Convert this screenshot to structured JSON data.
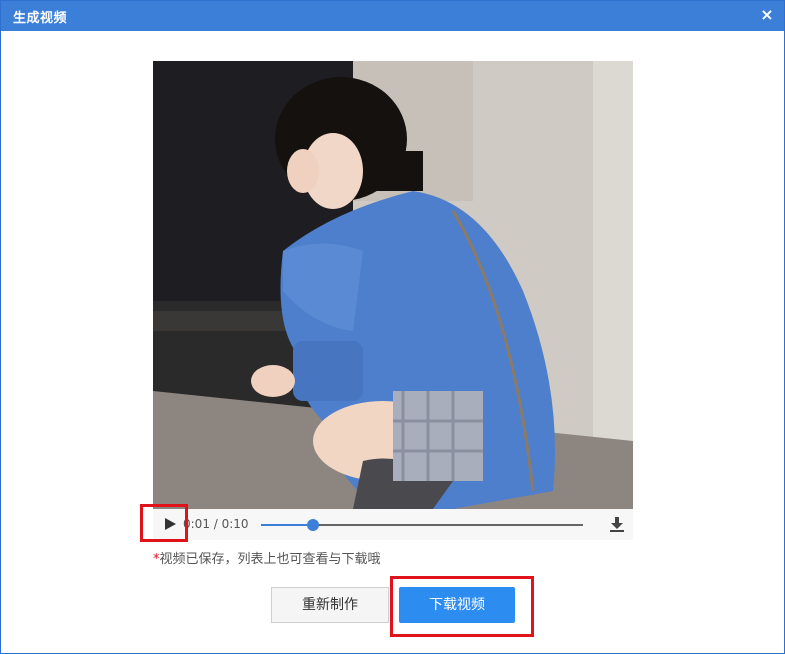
{
  "dialog": {
    "title": "生成视频",
    "close_label": "×"
  },
  "player": {
    "time": "0:01 / 0:10",
    "progress": 0.16,
    "icons": {
      "play": "play-icon",
      "download": "download-icon"
    }
  },
  "note": {
    "star": "*",
    "text": "视频已保存，列表上也可查看与下载哦"
  },
  "buttons": {
    "rebuild": "重新制作",
    "download": "下载视频"
  },
  "colors": {
    "titlebar": "#3b7fd9",
    "primary": "#2d8cf0",
    "highlight": "#e0121a"
  }
}
